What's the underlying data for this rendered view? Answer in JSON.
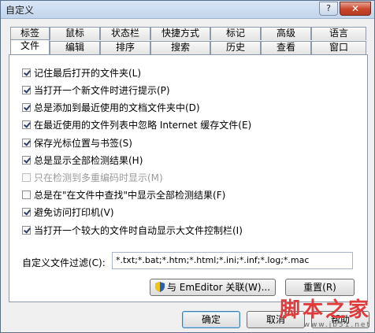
{
  "window": {
    "title": "自定义",
    "help_label": "?",
    "close_label": "✕"
  },
  "tabs": {
    "row1": [
      "标签",
      "鼠标",
      "状态栏",
      "快捷方式",
      "标记",
      "高级",
      "语言"
    ],
    "row2": [
      "文件",
      "编辑",
      "排序",
      "搜索",
      "历史",
      "查看",
      "窗口"
    ],
    "active": "文件"
  },
  "options": [
    {
      "label": "记住最后打开的文件夹(L)",
      "checked": true,
      "disabled": false
    },
    {
      "label": "当打开一个新文件时进行提示(P)",
      "checked": true,
      "disabled": false
    },
    {
      "label": "总是添加到最近使用的文档文件夹中(D)",
      "checked": true,
      "disabled": false
    },
    {
      "label": "在最近使用的文件列表中忽略 Internet 缓存文件(E)",
      "checked": true,
      "disabled": false
    },
    {
      "label": "保存光标位置与书签(S)",
      "checked": true,
      "disabled": false
    },
    {
      "label": "总是显示全部检测结果(H)",
      "checked": true,
      "disabled": false
    },
    {
      "label": "只在检测到多重编码时显示(M)",
      "checked": false,
      "disabled": true
    },
    {
      "label": "总是在\"在文件中查找\"中显示全部检测结果(F)",
      "checked": false,
      "disabled": false
    },
    {
      "label": "避免访问打印机(V)",
      "checked": true,
      "disabled": false
    },
    {
      "label": "当打开一个较大的文件时自动显示大文件控制栏(I)",
      "checked": true,
      "disabled": false
    }
  ],
  "filter": {
    "label": "自定义文件过滤(C):",
    "value": "*.txt;*.bat;*.htm;*.html;*.ini;*.inf;*.log;*.mac"
  },
  "buttons": {
    "associate": "与 EmEditor 关联(W)...",
    "reset": "重置(R)",
    "ok": "确定",
    "cancel": "取消",
    "help": "帮助"
  },
  "watermark": {
    "main": "脚本之家",
    "sub": "www.jb51.net"
  }
}
